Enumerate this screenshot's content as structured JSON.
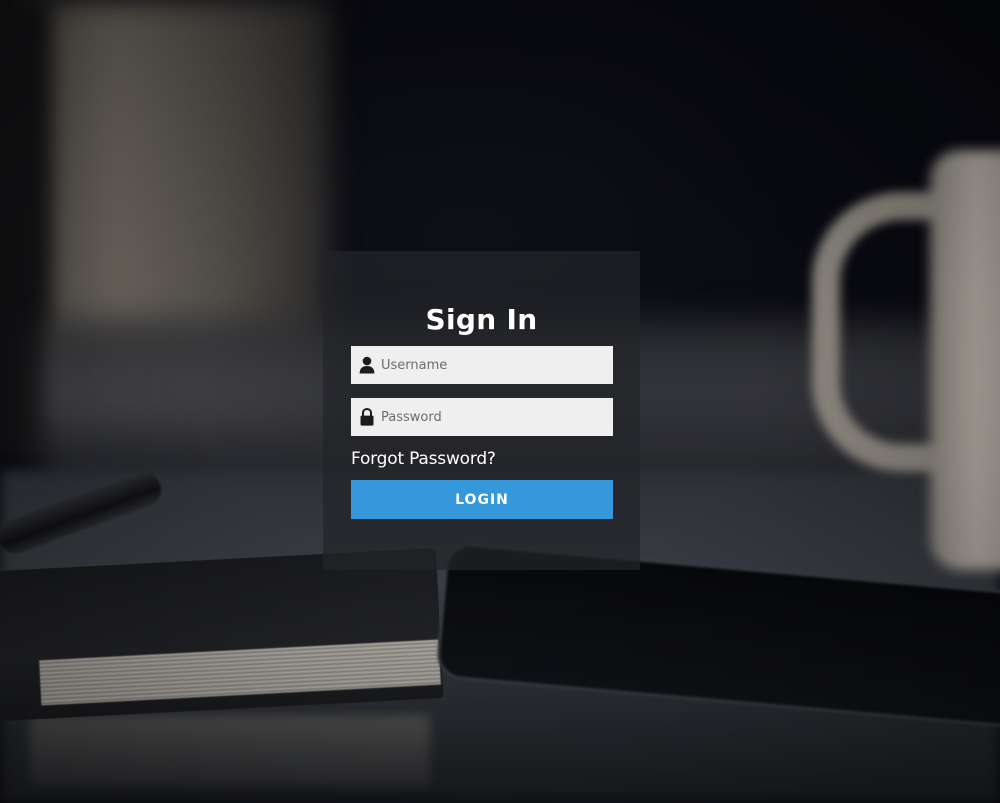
{
  "login": {
    "title": "Sign In",
    "username_placeholder": "Username",
    "password_placeholder": "Password",
    "forgot_password": "Forgot Password?",
    "login_button": "LOGIN"
  },
  "colors": {
    "button": "#3498db",
    "input_bg": "#efefef",
    "title_text": "#ffffff"
  },
  "icons": {
    "username": "user-icon",
    "password": "lock-icon"
  }
}
